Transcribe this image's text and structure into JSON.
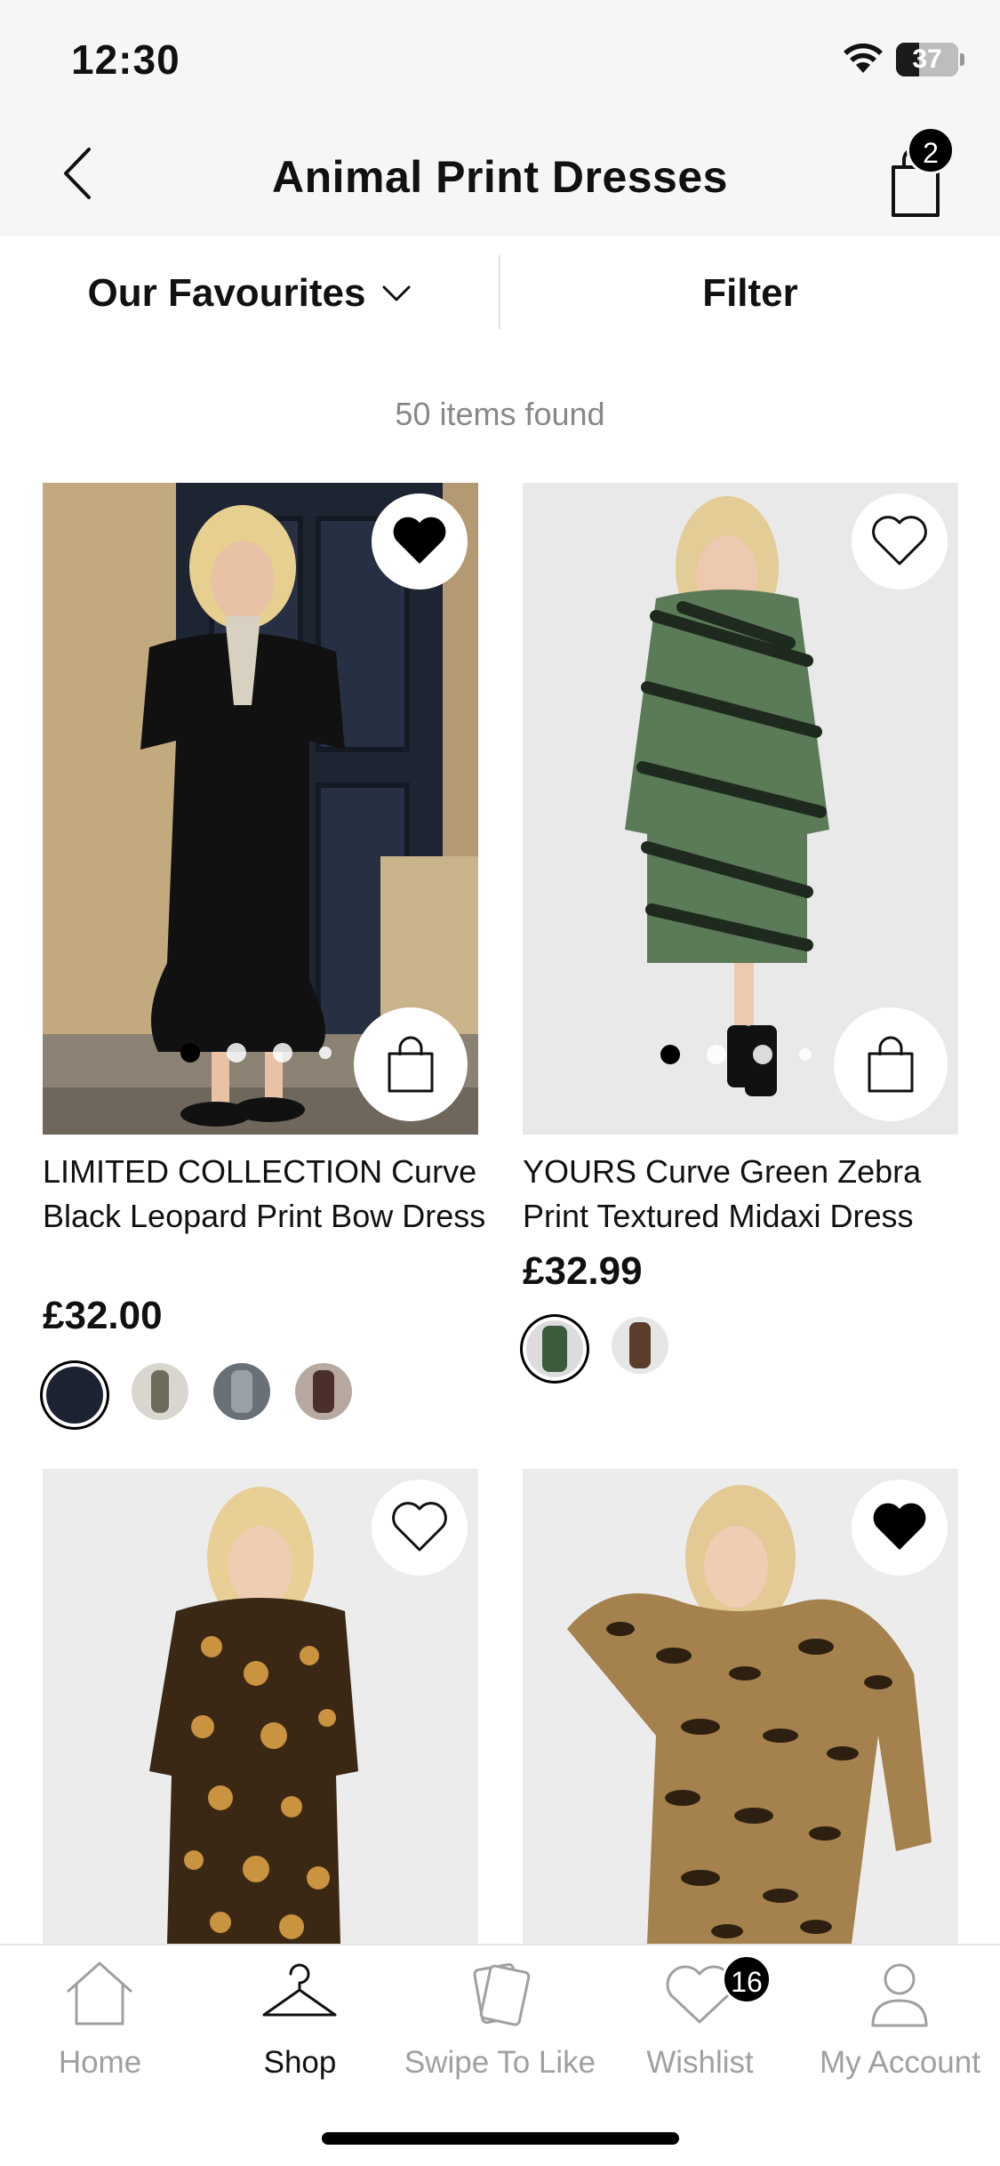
{
  "status_bar": {
    "time": "12:30",
    "battery_level": "37",
    "battery_fraction": 0.37
  },
  "header": {
    "title": "Animal Print Dresses",
    "cart_count": "2"
  },
  "toolbar": {
    "sort_label": "Our Favourites",
    "filter_label": "Filter"
  },
  "results": {
    "count_text": "50 items found"
  },
  "products": [
    {
      "name": "LIMITED COLLECTION Curve Black Leopard Print Bow Dress",
      "price": "£32.00",
      "wishlisted": true,
      "image_index": 0,
      "image_count": 4,
      "swatch_colors": [
        "#1d2233",
        "#6f6a5c",
        "#5a6470",
        "#4a2f2a"
      ]
    },
    {
      "name": "YOURS Curve Green Zebra Print Textured Midaxi Dress",
      "price": "£32.99",
      "wishlisted": false,
      "image_index": 0,
      "image_count": 4,
      "swatch_colors": [
        "#3d5a3d",
        "#5a3d2a"
      ]
    },
    {
      "wishlisted": false
    },
    {
      "wishlisted": true
    }
  ],
  "tab_bar": {
    "tabs": [
      {
        "label": "Home",
        "icon": "home-icon"
      },
      {
        "label": "Shop",
        "icon": "hanger-icon"
      },
      {
        "label": "Swipe To Like",
        "icon": "cards-icon"
      },
      {
        "label": "Wishlist",
        "icon": "heart-icon"
      },
      {
        "label": "My Account",
        "icon": "person-icon"
      }
    ],
    "active": "Shop",
    "wishlist_count": "16"
  }
}
